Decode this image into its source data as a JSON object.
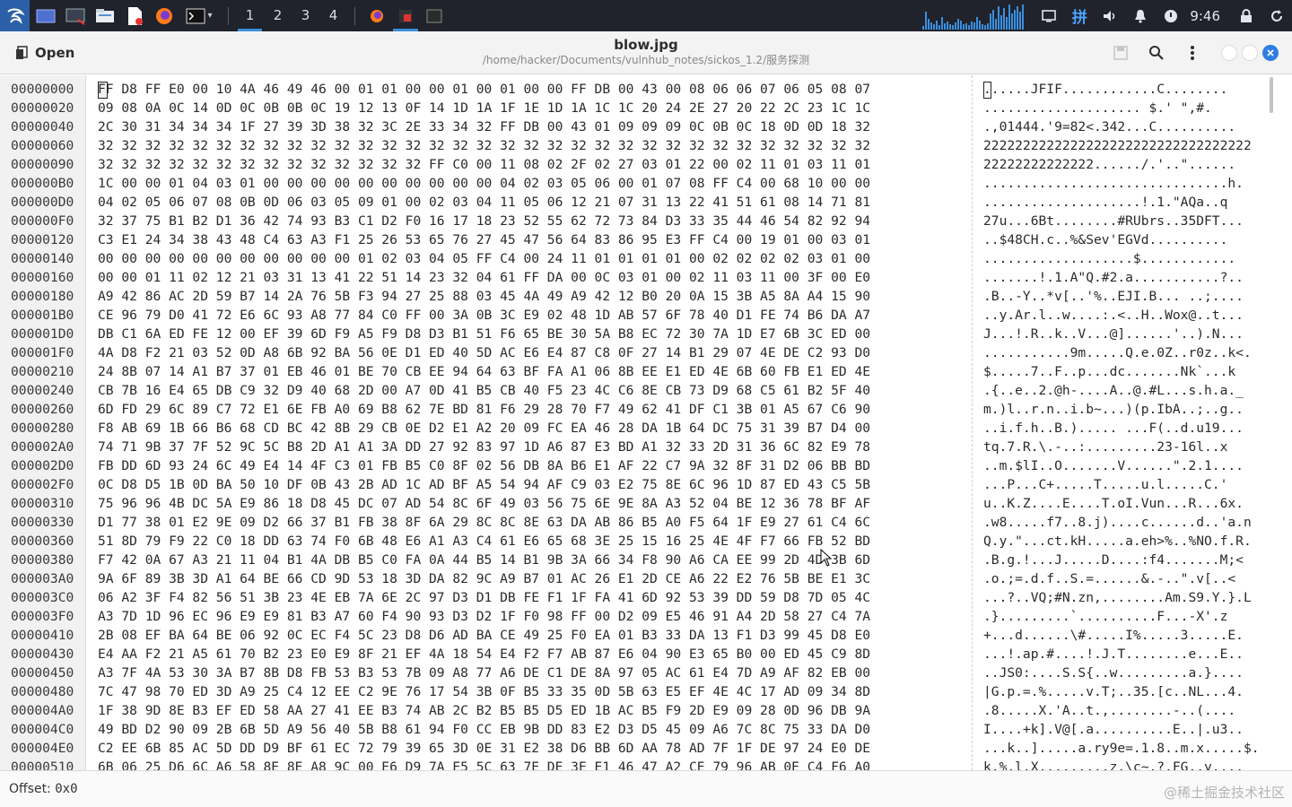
{
  "taskbar": {
    "workspaces": [
      "1",
      "2",
      "3",
      "4"
    ],
    "active_workspace": "1",
    "clock": "9:46",
    "accent": "#3b8fd9",
    "launchers": [
      "kali-menu-icon",
      "desktop-icon",
      "terminal-emulator-icon",
      "file-manager-icon",
      "text-editor-icon",
      "firefox-icon",
      "terminal-icon"
    ],
    "tray": [
      "monitor-icon",
      "input-method-icon",
      "volume-icon",
      "notification-bell-icon",
      "power-icon",
      "lock-icon",
      "refresh-icon"
    ]
  },
  "header": {
    "open_label": "Open",
    "title": "blow.jpg",
    "path": "/home/hacker/Documents/vulnhub_notes/sickos_1.2/服务探测"
  },
  "editor": {
    "offsets": [
      "00000000",
      "00000020",
      "00000040",
      "00000060",
      "00000090",
      "000000B0",
      "000000D0",
      "000000F0",
      "00000120",
      "00000140",
      "00000160",
      "00000180",
      "000001B0",
      "000001D0",
      "000001F0",
      "00000210",
      "00000240",
      "00000260",
      "00000280",
      "000002A0",
      "000002D0",
      "000002F0",
      "00000310",
      "00000330",
      "00000360",
      "00000380",
      "000003A0",
      "000003C0",
      "000003F0",
      "00000410",
      "00000430",
      "00000450",
      "00000480",
      "000004A0",
      "000004C0",
      "000004E0",
      "00000510"
    ],
    "hex_rows": [
      "FF D8 FF E0 00 10 4A 46 49 46 00 01 01 00 00 01 00 01 00 00 FF DB 00 43 00 08 06 06 07 06 05 08 07",
      "09 08 0A 0C 14 0D 0C 0B 0B 0C 19 12 13 0F 14 1D 1A 1F 1E 1D 1A 1C 1C 20 24 2E 27 20 22 2C 23 1C 1C",
      "2C 30 31 34 34 34 1F 27 39 3D 38 32 3C 2E 33 34 32 FF DB 00 43 01 09 09 09 0C 0B 0C 18 0D 0D 18 32",
      "32 32 32 32 32 32 32 32 32 32 32 32 32 32 32 32 32 32 32 32 32 32 32 32 32 32 32 32 32 32 32 32 32",
      "32 32 32 32 32 32 32 32 32 32 32 32 32 32 FF C0 00 11 08 02 2F 02 27 03 01 22 00 02 11 01 03 11 01",
      "1C 00 00 01 04 03 01 00 00 00 00 00 00 00 00 00 00 04 02 03 05 06 00 01 07 08 FF C4 00 68 10 00 00",
      "04 02 05 06 07 08 0B 0D 06 03 05 09 01 00 02 03 04 11 05 06 12 21 07 31 13 22 41 51 61 08 14 71 81",
      "32 37 75 B1 B2 D1 36 42 74 93 B3 C1 D2 F0 16 17 18 23 52 55 62 72 73 84 D3 33 35 44 46 54 82 92 94",
      "C3 E1 24 34 38 43 48 C4 63 A3 F1 25 26 53 65 76 27 45 47 56 64 83 86 95 E3 FF C4 00 19 01 00 03 01",
      "00 00 00 00 00 00 00 00 00 00 00 01 02 03 04 05 FF C4 00 24 11 01 01 01 01 00 02 02 02 02 03 01 00",
      "00 00 01 11 02 12 21 03 31 13 41 22 51 14 23 32 04 61 FF DA 00 0C 03 01 00 02 11 03 11 00 3F 00 E0",
      "A9 42 86 AC 2D 59 B7 14 2A 76 5B F3 94 27 25 88 03 45 4A 49 A9 42 12 B0 20 0A 15 3B A5 8A A4 15 90",
      "CE 96 79 D0 41 72 E6 6C 93 A8 77 84 C0 FF 00 3A 0B 3C E9 02 48 1D AB 57 6F 78 40 D1 FE 74 B6 DA A7",
      "DB C1 6A ED FE 12 00 EF 39 6D F9 A5 F9 D8 D3 B1 51 F6 65 BE 30 5A B8 EC 72 30 7A 1D E7 6B 3C ED 00",
      "4A D8 F2 21 03 52 0D A8 6B 92 BA 56 0E D1 ED 40 5D AC E6 E4 87 C8 0F 27 14 B1 29 07 4E DE C2 93 D0",
      "24 8B 07 14 A1 B7 37 01 EB 46 01 BE 70 CB EE 94 64 63 BF FA A1 06 8B EE E1 ED 4E 6B 60 FB E1 ED 4E",
      "CB 7B 16 E4 65 DB C9 32 D9 40 68 2D 00 A7 0D 41 B5 CB 40 F5 23 4C C6 8E CB 73 D9 68 C5 61 B2 5F 40",
      "6D FD 29 6C 89 C7 72 E1 6E FB A0 69 B8 62 7E BD 81 F6 29 28 70 F7 49 62 41 DF C1 3B 01 A5 67 C6 90",
      "F8 AB 69 1B 66 B6 68 CD BC 42 8B 29 CB 0E D2 E1 A2 20 09 FC EA 46 28 DA 1B 64 DC 75 31 39 B7 D4 00",
      "74 71 9B 37 7F 52 9C 5C B8 2D A1 A1 3A DD 27 92 83 97 1D A6 87 E3 BD A1 32 33 2D 31 36 6C 82 E9 78",
      "FB DD 6D 93 24 6C 49 E4 14 4F C3 01 FB B5 C0 8F 02 56 DB 8A B6 E1 AF 22 C7 9A 32 8F 31 D2 06 BB BD",
      "0C D8 D5 1B 0D BA 50 10 DF 0B 43 2B AD 1C AD BF A5 54 94 AF C9 03 E2 75 8E 6C 96 1D 87 ED 43 C5 5B",
      "75 96 96 4B DC 5A E9 86 18 D8 45 DC 07 AD 54 8C 6F 49 03 56 75 6E 9E 8A A3 52 04 BE 12 36 78 BF AF",
      "D1 77 38 01 E2 9E 09 D2 66 37 B1 FB 38 8F 6A 29 8C 8C 8E 63 DA AB 86 B5 A0 F5 64 1F E9 27 61 C4 6C",
      "51 8D 79 F9 22 C0 18 DD 63 74 F0 6B 48 E6 A1 A3 C4 61 E6 65 68 3E 25 15 16 25 4E 4F F7 66 FB 52 BD",
      "F7 42 0A 67 A3 21 11 04 B1 4A DB B5 C0 FA 0A 44 B5 14 B1 9B 3A 66 34 F8 90 A6 CA EE 99 2D 4D 3B 6D",
      "9A 6F 89 3B 3D A1 64 BE 66 CD 9D 53 18 3D DA 82 9C A9 B7 01 AC 26 E1 2D CE A6 22 E2 76 5B BE E1 3C",
      "06 A2 3F F4 82 56 51 3B 23 4E EB 7A 6E 2C 97 D3 D1 DB FE F1 1F FA 41 6D 92 53 39 DD 59 D8 7D 05 4C",
      "A3 7D 1D 96 EC 96 E9 E9 81 B3 A7 60 F4 90 93 D3 D2 1F F0 98 FF 00 D2 09 E5 46 91 A4 2D 58 27 C4 7A",
      "2B 08 EF BA 64 BE 06 92 0C EC F4 5C 23 D8 D6 AD BA CE 49 25 F0 EA 01 B3 33 DA 13 F1 D3 99 45 D8 E0",
      "E4 AA F2 21 A5 61 70 B2 23 E0 E9 8F 21 EF 4A 18 54 E4 F2 F7 AB 87 E6 04 90 E3 65 B0 00 ED 45 C9 8D",
      "A3 7F 4A 53 30 3A B7 8B D8 FB 53 B3 53 7B 09 A8 77 A6 DE C1 DE 8A 97 05 AC 61 E4 7D A9 AF 82 EB 00",
      "7C 47 98 70 ED 3D A9 25 C4 12 EE C2 9E 76 17 54 3B 0F B5 33 35 0D 5B 63 E5 EF 4E 4C 17 AD 09 34 8D",
      "1F 38 9D 8E B3 EF ED 58 AA 27 41 EE B3 74 AB 2C B2 B5 B5 D5 ED 1B AC B5 F9 2D E9 09 28 0D 96 DB 9A",
      "49 BD D2 90 09 2B 6B 5D A9 56 40 5B B8 61 94 F0 CC EB 9B DD 83 E2 D3 D5 45 09 A6 7C 8C 75 33 DA D0",
      "C2 EE 6B 85 AC 5D DD D9 BF 61 EC 72 79 39 65 3D 0E 31 E2 38 D6 BB 6D AA 78 AD 7F 1F DE 97 24 E0 DE",
      "6B 06 25 D6 6C A6 58 8E 8E A8 9C 00 E6 D9 7A E5 5C 63 7E DE 3E E1 46 47 A2 CE 79 96 AB 0E C4 F6 A0"
    ],
    "ascii_rows": [
      "......JFIF............C........",
      ".................... $.' \",#.",
      ".,01444.'9=82<.342...C..........",
      "2222222222222222222222222222222222",
      "22222222222222....../.'..\"......",
      "...............................h.",
      "....................!.1.\"AQa..q",
      "27u...6Bt........#RUbrs..35DFT...",
      "..$48CH.c..%&Sev'EGVd..........",
      "...................$............",
      ".......!.1.A\"Q.#2.a...........?..",
      ".B..-Y..*v[..'%..EJI.B... ..;....",
      "..y.Ar.l..w....:.<..H..Wox@..t...",
      "J...!.R..k..V...@]......'..).N...",
      "...........9m.....Q.e.0Z..r0z..k<.",
      "$.....7..F..p...dc.......Nk`...k",
      ".{..e..2.@h-....A..@.#L...s.h.a._",
      "m.)l..r.n..i.b~...)(p.IbA..;..g..",
      "..i.f.h..B.)..... ...F(..d.u19...",
      "tq.7.R.\\.-..:.........23-16l..x",
      "..m.$lI..O.......V......\".2.1....",
      "...P...C+.....T.....u.l.....C.'",
      "u..K.Z....E....T.oI.Vun...R...6x.",
      ".w8.....f7..8.j)....c......d..'a.n",
      "Q.y.\"...ct.kH.....a.eh>%..%NO.f.R.",
      ".B.g.!...J.....D....:f4.......M;<",
      ".o.;=.d.f..S.=......&.-..\".v[..<",
      "...?..VQ;#N.zn,........Am.S9.Y.}.L",
      ".}.........`..........F...-X'.z",
      "+...d......\\#.....I%.....3.....E.",
      "...!.ap.#....!.J.T........e...E..",
      "..JS0:....S.S{..w.........a.}....",
      "|G.p.=.%.....v.T;..35.[c..NL...4.",
      ".8.....X.'A..t.,........-..(....",
      "I....+k].V@[.a..........E..|.u3..",
      "...k..].....a.ry9e=.1.8..m.x.....$.",
      "k.%.l.X.........z.\\c~.?.FG..y...."
    ]
  },
  "status": {
    "offset_label": "Offset:",
    "offset_value": "0x0",
    "watermark": "@稀土掘金技术社区"
  }
}
